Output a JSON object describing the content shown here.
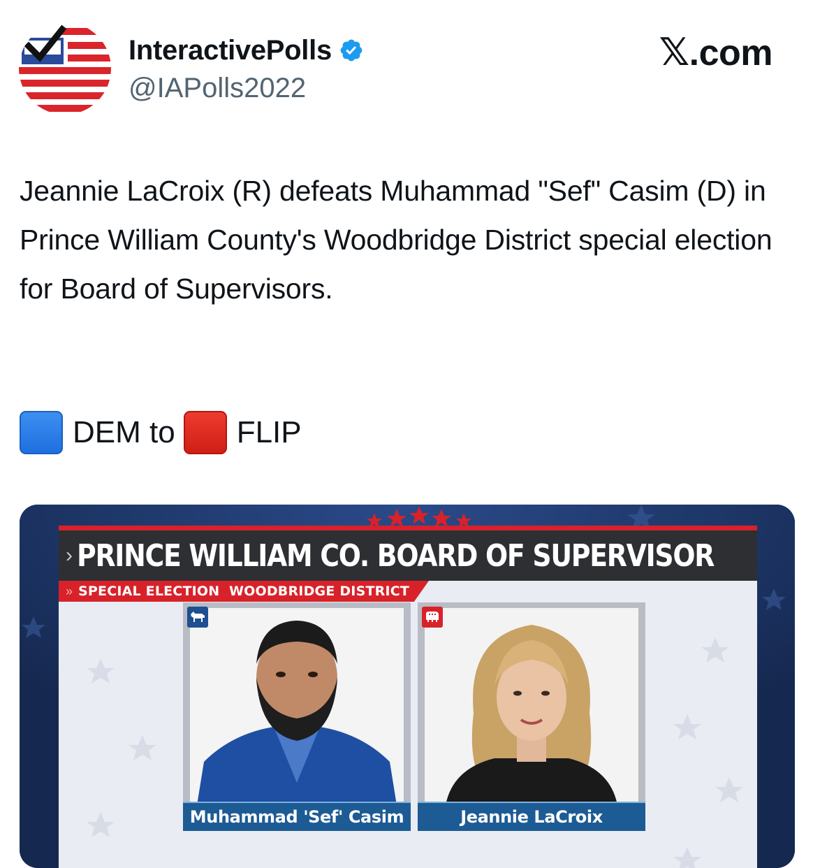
{
  "author": {
    "display_name": "InteractivePolls",
    "handle": "@IAPolls2022",
    "verified": true
  },
  "brand": {
    "x_glyph": "𝕏",
    "suffix": ".com"
  },
  "tweet": {
    "text": "Jeannie LaCroix (R) defeats Muhammad \"Sef\" Casim (D) in Prince William County's Woodbridge District special election for Board of Supervisors.",
    "flip_from": "DEM to",
    "flip_to": "FLIP"
  },
  "media": {
    "title": "PRINCE WILLIAM CO. BOARD OF SUPERVISOR",
    "title_chevron": "›",
    "subtitle": "SPECIAL ELECTION  WOODBRIDGE DISTRICT",
    "subtitle_chevron": "»",
    "candidates": [
      {
        "name": "Muhammad 'Sef' Casim",
        "party": "D",
        "party_icon": "donkey-icon"
      },
      {
        "name": "Jeannie LaCroix",
        "party": "R",
        "party_icon": "elephant-icon"
      }
    ]
  },
  "colors": {
    "dem_blue": "#1f6fe0",
    "rep_red": "#d8222a",
    "verified_blue": "#1d9bf0",
    "nameplate_blue": "#1d5b94",
    "title_bar": "#2e2f33"
  }
}
